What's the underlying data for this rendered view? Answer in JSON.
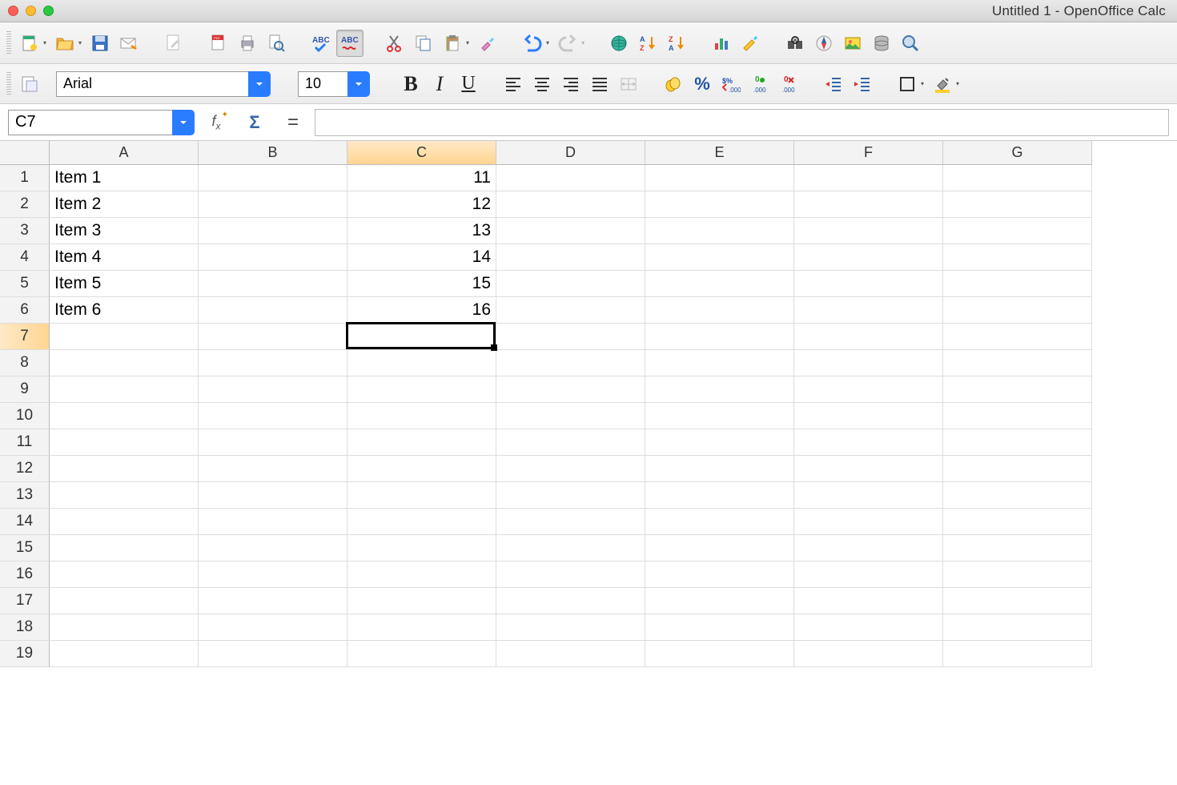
{
  "window": {
    "title": "Untitled 1 - OpenOffice Calc"
  },
  "toolbar2": {
    "font_name": "Arial",
    "font_size": "10"
  },
  "formula_bar": {
    "cell_ref": "C7",
    "formula": ""
  },
  "columns": [
    "A",
    "B",
    "C",
    "D",
    "E",
    "F",
    "G"
  ],
  "rows": [
    "1",
    "2",
    "3",
    "4",
    "5",
    "6",
    "7",
    "8",
    "9",
    "10",
    "11",
    "12",
    "13",
    "14",
    "15",
    "16",
    "17",
    "18",
    "19"
  ],
  "active_col": "C",
  "active_row": "7",
  "cell_data": {
    "A1": "Item 1",
    "A2": "Item 2",
    "A3": "Item 3",
    "A4": "Item 4",
    "A5": "Item 5",
    "A6": "Item 6",
    "C1": "11",
    "C2": "12",
    "C3": "13",
    "C4": "14",
    "C5": "15",
    "C6": "16"
  },
  "numeric_cols": [
    "C"
  ],
  "selection": {
    "col": "C",
    "row": "7"
  }
}
